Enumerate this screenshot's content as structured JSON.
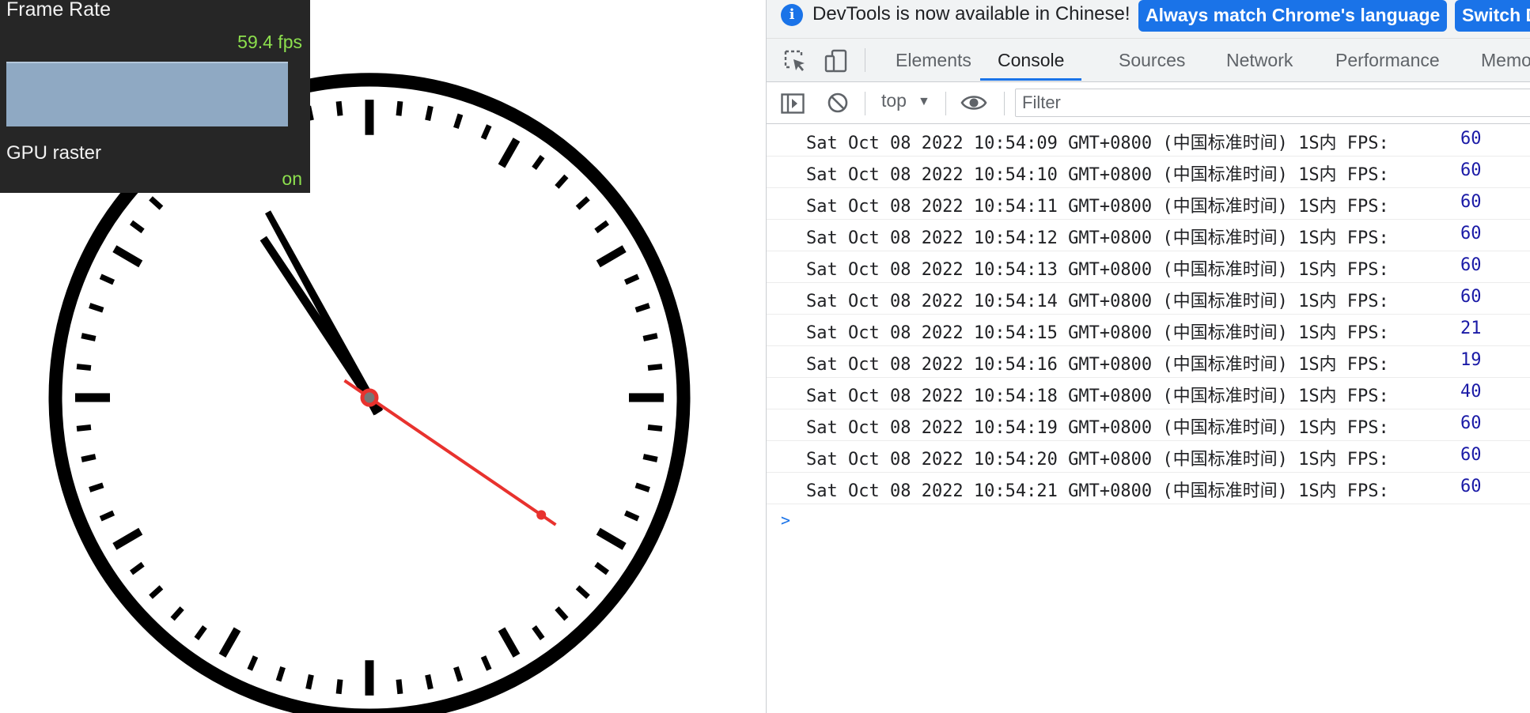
{
  "fps_meter": {
    "title": "Frame Rate",
    "fps_value": "59.4 fps",
    "gpu_raster_label": "GPU raster",
    "gpu_raster_value": "on"
  },
  "clock": {
    "hour_angle_deg": 326,
    "minute_angle_deg": 331,
    "second_angle_deg": 124,
    "second_hand_color": "#e8322e"
  },
  "devtools": {
    "infobar": {
      "message": "DevTools is now available in Chinese!",
      "match_button": "Always match Chrome's language",
      "switch_button": "Switch D"
    },
    "tabs": {
      "elements": "Elements",
      "console": "Console",
      "sources": "Sources",
      "network": "Network",
      "performance": "Performance",
      "memory": "Memo"
    },
    "toolbar": {
      "context": "top",
      "filter_placeholder": "Filter"
    },
    "console_rows": [
      {
        "message": "Sat Oct 08 2022 10:54:09 GMT+0800 (中国标准时间) 1S内 FPS:",
        "value": "60"
      },
      {
        "message": "Sat Oct 08 2022 10:54:10 GMT+0800 (中国标准时间) 1S内 FPS:",
        "value": "60"
      },
      {
        "message": "Sat Oct 08 2022 10:54:11 GMT+0800 (中国标准时间) 1S内 FPS:",
        "value": "60"
      },
      {
        "message": "Sat Oct 08 2022 10:54:12 GMT+0800 (中国标准时间) 1S内 FPS:",
        "value": "60"
      },
      {
        "message": "Sat Oct 08 2022 10:54:13 GMT+0800 (中国标准时间) 1S内 FPS:",
        "value": "60"
      },
      {
        "message": "Sat Oct 08 2022 10:54:14 GMT+0800 (中国标准时间) 1S内 FPS:",
        "value": "60"
      },
      {
        "message": "Sat Oct 08 2022 10:54:15 GMT+0800 (中国标准时间) 1S内 FPS:",
        "value": "21"
      },
      {
        "message": "Sat Oct 08 2022 10:54:16 GMT+0800 (中国标准时间) 1S内 FPS:",
        "value": "19"
      },
      {
        "message": "Sat Oct 08 2022 10:54:18 GMT+0800 (中国标准时间) 1S内 FPS:",
        "value": "40"
      },
      {
        "message": "Sat Oct 08 2022 10:54:19 GMT+0800 (中国标准时间) 1S内 FPS:",
        "value": "60"
      },
      {
        "message": "Sat Oct 08 2022 10:54:20 GMT+0800 (中国标准时间) 1S内 FPS:",
        "value": "60"
      },
      {
        "message": "Sat Oct 08 2022 10:54:21 GMT+0800 (中国标准时间) 1S内 FPS:",
        "value": "60"
      }
    ],
    "prompt_symbol": ">"
  }
}
